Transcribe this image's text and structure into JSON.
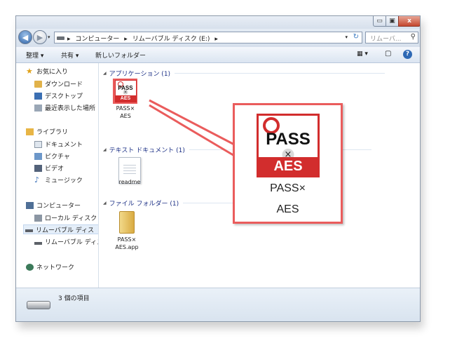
{
  "window": {
    "caption_buttons": [
      "minimize",
      "maximize",
      "close"
    ],
    "close_glyph": "x",
    "minimize_glyph": "▭",
    "maximize_glyph": "▣"
  },
  "nav": {
    "back_glyph": "◀",
    "forward_glyph": "▶",
    "dropdown_glyph": "▾"
  },
  "address": {
    "sep": "▸",
    "crumbs": [
      "コンピューター",
      "リムーバブル ディスク (E:)"
    ],
    "dropdown_glyph": "▾",
    "refresh_glyph": "↻"
  },
  "search": {
    "placeholder": "リムーバ...",
    "icon": "search-icon",
    "glyph": "⚲"
  },
  "toolbar": {
    "organize_label": "整理 ▾",
    "share_label": "共有 ▾",
    "new_folder_label": "新しいフォルダー",
    "view_glyph": "▦ ▾",
    "preview_glyph": "▢",
    "help_glyph": "?"
  },
  "sidebar": {
    "favorites": {
      "header": "お気に入り",
      "items": [
        "ダウンロード",
        "デスクトップ",
        "最近表示した場所"
      ]
    },
    "libraries": {
      "header": "ライブラリ",
      "items": [
        "ドキュメント",
        "ピクチャ",
        "ビデオ",
        "ミュージック"
      ]
    },
    "computer": {
      "header": "コンピューター",
      "items": [
        "ローカル ディスク (",
        "リムーバブル ディス",
        "リムーバブル ディス"
      ]
    },
    "network": {
      "header": "ネットワーク"
    }
  },
  "content": {
    "groups": [
      {
        "title": "アプリケーション (1)",
        "items": [
          {
            "line1": "PASS×",
            "line2": "AES"
          }
        ]
      },
      {
        "title": "テキスト ドキュメント (1)",
        "items": [
          {
            "line1": "readme"
          }
        ]
      },
      {
        "title": "ファイル フォルダー (1)",
        "items": [
          {
            "line1": "PASS×",
            "line2": "AES.app"
          }
        ]
      }
    ],
    "group_toggle_glyph": "◢"
  },
  "app_icon": {
    "word": "PASS",
    "cross": "×",
    "band": "AES"
  },
  "callout": {
    "line1": "PASS×",
    "line2": "AES"
  },
  "status": {
    "item_count": "3 個の項目"
  },
  "colors": {
    "highlight": "#ea5c5c",
    "brand_red": "#d22d2d",
    "group_title": "#1e3287"
  }
}
